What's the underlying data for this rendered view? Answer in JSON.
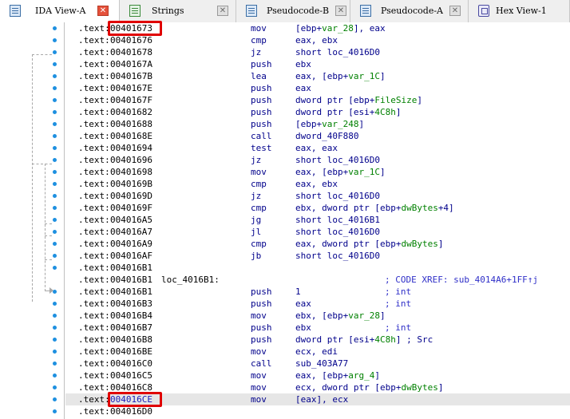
{
  "tabs": [
    {
      "label": "IDA View-A",
      "icon": "listing-icon",
      "active": true,
      "closable": true
    },
    {
      "label": "Strings",
      "icon": "strings-icon",
      "active": false,
      "closable": true
    },
    {
      "label": "Pseudocode-B",
      "icon": "listing-icon",
      "active": false,
      "closable": true
    },
    {
      "label": "Pseudocode-A",
      "icon": "listing-icon",
      "active": false,
      "closable": true
    },
    {
      "label": "Hex View-1",
      "icon": "hex-icon",
      "active": false,
      "closable": false
    }
  ],
  "close_glyph": "✕",
  "listing": {
    "segment": ".text:",
    "lines": [
      {
        "addr": "00401673",
        "label": "",
        "mnem": "mov",
        "ops": [
          [
            "[ebp+",
            ""
          ],
          [
            "var_28",
            "g"
          ],
          [
            "], eax",
            ""
          ]
        ],
        "comment": ""
      },
      {
        "addr": "00401676",
        "label": "",
        "mnem": "cmp",
        "ops": [
          [
            "eax, ebx",
            ""
          ]
        ],
        "comment": ""
      },
      {
        "addr": "00401678",
        "label": "",
        "mnem": "jz",
        "ops": [
          [
            "short loc_4016D0",
            ""
          ]
        ],
        "comment": ""
      },
      {
        "addr": "0040167A",
        "label": "",
        "mnem": "push",
        "ops": [
          [
            "ebx",
            ""
          ]
        ],
        "comment": ""
      },
      {
        "addr": "0040167B",
        "label": "",
        "mnem": "lea",
        "ops": [
          [
            "eax, [ebp+",
            ""
          ],
          [
            "var_1C",
            "g"
          ],
          [
            "]",
            ""
          ]
        ],
        "comment": ""
      },
      {
        "addr": "0040167E",
        "label": "",
        "mnem": "push",
        "ops": [
          [
            "eax",
            ""
          ]
        ],
        "comment": ""
      },
      {
        "addr": "0040167F",
        "label": "",
        "mnem": "push",
        "ops": [
          [
            "dword ptr [ebp+",
            ""
          ],
          [
            "FileSize",
            "g"
          ],
          [
            "]",
            ""
          ]
        ],
        "comment": ""
      },
      {
        "addr": "00401682",
        "label": "",
        "mnem": "push",
        "ops": [
          [
            "dword ptr [esi+",
            ""
          ],
          [
            "4C8h",
            "g"
          ],
          [
            "]",
            ""
          ]
        ],
        "comment": ""
      },
      {
        "addr": "00401688",
        "label": "",
        "mnem": "push",
        "ops": [
          [
            "[ebp+",
            ""
          ],
          [
            "var_248",
            "g"
          ],
          [
            "]",
            ""
          ]
        ],
        "comment": ""
      },
      {
        "addr": "0040168E",
        "label": "",
        "mnem": "call",
        "ops": [
          [
            "dword_40F880",
            ""
          ]
        ],
        "comment": ""
      },
      {
        "addr": "00401694",
        "label": "",
        "mnem": "test",
        "ops": [
          [
            "eax, eax",
            ""
          ]
        ],
        "comment": ""
      },
      {
        "addr": "00401696",
        "label": "",
        "mnem": "jz",
        "ops": [
          [
            "short loc_4016D0",
            ""
          ]
        ],
        "comment": ""
      },
      {
        "addr": "00401698",
        "label": "",
        "mnem": "mov",
        "ops": [
          [
            "eax, [ebp+",
            ""
          ],
          [
            "var_1C",
            "g"
          ],
          [
            "]",
            ""
          ]
        ],
        "comment": ""
      },
      {
        "addr": "0040169B",
        "label": "",
        "mnem": "cmp",
        "ops": [
          [
            "eax, ebx",
            ""
          ]
        ],
        "comment": ""
      },
      {
        "addr": "0040169D",
        "label": "",
        "mnem": "jz",
        "ops": [
          [
            "short loc_4016D0",
            ""
          ]
        ],
        "comment": ""
      },
      {
        "addr": "0040169F",
        "label": "",
        "mnem": "cmp",
        "ops": [
          [
            "ebx, dword ptr [ebp+",
            ""
          ],
          [
            "dwBytes",
            "g"
          ],
          [
            "+4]",
            ""
          ]
        ],
        "comment": ""
      },
      {
        "addr": "004016A5",
        "label": "",
        "mnem": "jg",
        "ops": [
          [
            "short loc_4016B1",
            ""
          ]
        ],
        "comment": ""
      },
      {
        "addr": "004016A7",
        "label": "",
        "mnem": "jl",
        "ops": [
          [
            "short loc_4016D0",
            ""
          ]
        ],
        "comment": ""
      },
      {
        "addr": "004016A9",
        "label": "",
        "mnem": "cmp",
        "ops": [
          [
            "eax, dword ptr [ebp+",
            ""
          ],
          [
            "dwBytes",
            "g"
          ],
          [
            "]",
            ""
          ]
        ],
        "comment": ""
      },
      {
        "addr": "004016AF",
        "label": "",
        "mnem": "jb",
        "ops": [
          [
            "short loc_4016D0",
            ""
          ]
        ],
        "comment": ""
      },
      {
        "addr": "004016B1",
        "label": "",
        "mnem": "",
        "ops": [],
        "comment": ""
      },
      {
        "addr": "004016B1",
        "label": "loc_4016B1:",
        "mnem": "",
        "ops": [],
        "comment": "; CODE XREF: sub_4014A6+1FF↑j"
      },
      {
        "addr": "004016B1",
        "label": "",
        "mnem": "push",
        "ops": [
          [
            "1",
            ""
          ]
        ],
        "comment": "; int"
      },
      {
        "addr": "004016B3",
        "label": "",
        "mnem": "push",
        "ops": [
          [
            "eax",
            ""
          ]
        ],
        "comment": "; int"
      },
      {
        "addr": "004016B4",
        "label": "",
        "mnem": "mov",
        "ops": [
          [
            "ebx, [ebp+",
            ""
          ],
          [
            "var_28",
            "g"
          ],
          [
            "]",
            ""
          ]
        ],
        "comment": ""
      },
      {
        "addr": "004016B7",
        "label": "",
        "mnem": "push",
        "ops": [
          [
            "ebx",
            ""
          ]
        ],
        "comment": "; int"
      },
      {
        "addr": "004016B8",
        "label": "",
        "mnem": "push",
        "ops": [
          [
            "dword ptr [esi+",
            ""
          ],
          [
            "4C8h",
            "g"
          ],
          [
            "] ; Src",
            ""
          ]
        ],
        "comment": ""
      },
      {
        "addr": "004016BE",
        "label": "",
        "mnem": "mov",
        "ops": [
          [
            "ecx, edi",
            ""
          ]
        ],
        "comment": ""
      },
      {
        "addr": "004016C0",
        "label": "",
        "mnem": "call",
        "ops": [
          [
            "sub_403A77",
            ""
          ]
        ],
        "comment": ""
      },
      {
        "addr": "004016C5",
        "label": "",
        "mnem": "mov",
        "ops": [
          [
            "eax, [ebp+",
            ""
          ],
          [
            "arg_4",
            "g"
          ],
          [
            "]",
            ""
          ]
        ],
        "comment": ""
      },
      {
        "addr": "004016C8",
        "label": "",
        "mnem": "mov",
        "ops": [
          [
            "ecx, dword ptr [ebp+",
            ""
          ],
          [
            "dwBytes",
            "g"
          ],
          [
            "]",
            ""
          ]
        ],
        "comment": ""
      },
      {
        "addr": "004016CE",
        "label": "",
        "mnem": "mov",
        "ops": [
          [
            "[eax], ecx",
            ""
          ]
        ],
        "comment": ""
      },
      {
        "addr": "004016D0",
        "label": "",
        "mnem": "",
        "ops": [],
        "comment": ""
      }
    ]
  },
  "current_line_index": 31,
  "boxed_line_indices": [
    0,
    31
  ],
  "arrow_dot_line_indices": [
    0,
    1,
    2,
    3,
    4,
    5,
    6,
    7,
    8,
    9,
    10,
    11,
    12,
    13,
    14,
    15,
    16,
    17,
    18,
    19,
    20,
    22,
    23,
    24,
    25,
    26,
    27,
    28,
    29,
    30,
    31,
    32
  ],
  "colors": {
    "mnemonic": "#00008b",
    "name": "#008000",
    "comment": "#2f2fc8",
    "selected_address": "#1a1ab8",
    "highlight_box": "#e00000",
    "active_close": "#e5513b",
    "arrow_dot": "#1e90e0"
  }
}
